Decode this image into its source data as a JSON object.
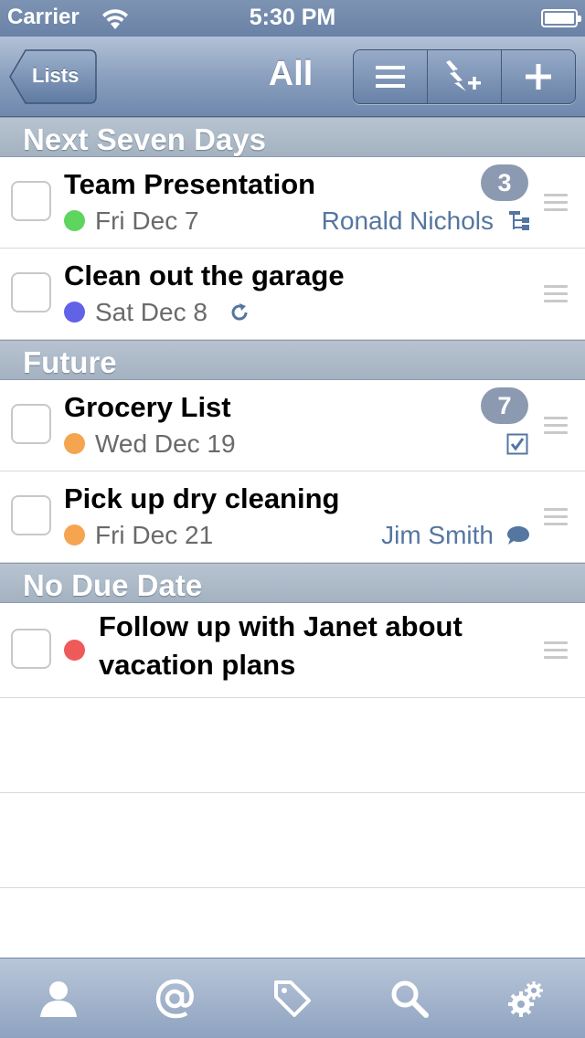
{
  "status_bar": {
    "carrier": "Carrier",
    "time": "5:30 PM"
  },
  "nav": {
    "back_label": "Lists",
    "title": "All"
  },
  "colors": {
    "green": "#5ed55e",
    "blue": "#6262e6",
    "orange": "#f5a44f",
    "red": "#ee5a5a",
    "accent_text": "#5476a1",
    "badge": "#8c9ab1"
  },
  "sections": [
    {
      "title": "Next Seven Days"
    },
    {
      "title": "Future"
    },
    {
      "title": "No Due Date"
    }
  ],
  "tasks": [
    {
      "title": "Team Presentation",
      "date": "Fri Dec 7",
      "priority_color": "green",
      "assignee": "Ronald Nichols",
      "badge": "3",
      "icon": "subtasks-icon"
    },
    {
      "title": "Clean out the garage",
      "date": "Sat Dec 8",
      "priority_color": "blue",
      "icon": "repeat-icon"
    },
    {
      "title": "Grocery List",
      "date": "Wed Dec 19",
      "priority_color": "orange",
      "badge": "7",
      "icon": "checklist-icon"
    },
    {
      "title": "Pick up dry cleaning",
      "date": "Fri Dec 21",
      "priority_color": "orange",
      "assignee": "Jim Smith",
      "icon": "comment-icon"
    },
    {
      "title_line1": "Follow up with Janet about",
      "title_line2": "vacation plans",
      "priority_color": "red"
    }
  ],
  "toolbar": [
    "list-icon",
    "quick-add-icon",
    "add-icon"
  ],
  "tabs": [
    "person-icon",
    "at-icon",
    "tag-icon",
    "search-icon",
    "gear-icon"
  ]
}
